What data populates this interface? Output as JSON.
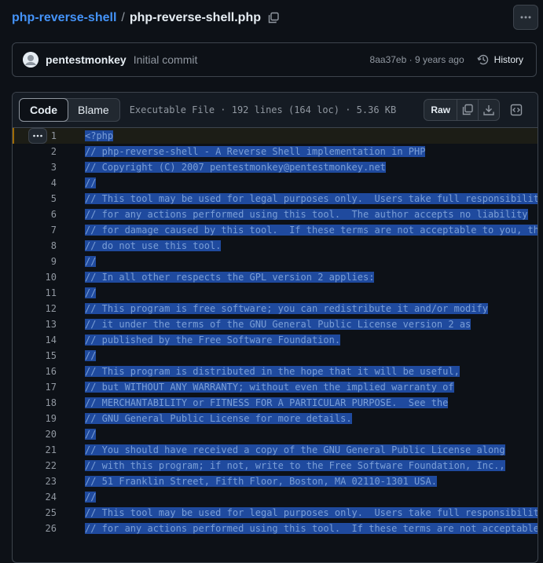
{
  "breadcrumb": {
    "repo": "php-reverse-shell",
    "separator": "/",
    "file": "php-reverse-shell.php"
  },
  "commit": {
    "author": "pentestmonkey",
    "message": "Initial commit",
    "sha": "8aa37eb",
    "age": "9 years ago",
    "history_label": "History"
  },
  "file_header": {
    "tabs": [
      {
        "label": "Code",
        "active": true
      },
      {
        "label": "Blame",
        "active": false
      }
    ],
    "info": "Executable File · 192 lines (164 loc) · 5.36 KB",
    "raw_label": "Raw"
  },
  "colors": {
    "accent": "#4493f8",
    "selection": "#1f4a9e",
    "background": "#0d1117"
  },
  "icons": [
    "copy-icon",
    "kebab-icon",
    "history-icon",
    "download-icon",
    "symbols-icon",
    "ellipsis-icon"
  ],
  "code_lines": [
    {
      "n": "1",
      "t": "<?php"
    },
    {
      "n": "2",
      "t": "// php-reverse-shell - A Reverse Shell implementation in PHP"
    },
    {
      "n": "3",
      "t": "// Copyright (C) 2007 pentestmonkey@pentestmonkey.net"
    },
    {
      "n": "4",
      "t": "//"
    },
    {
      "n": "5",
      "t": "// This tool may be used for legal purposes only.  Users take full responsibilit"
    },
    {
      "n": "6",
      "t": "// for any actions performed using this tool.  The author accepts no liability"
    },
    {
      "n": "7",
      "t": "// for damage caused by this tool.  If these terms are not acceptable to you, th"
    },
    {
      "n": "8",
      "t": "// do not use this tool."
    },
    {
      "n": "9",
      "t": "//"
    },
    {
      "n": "10",
      "t": "// In all other respects the GPL version 2 applies:"
    },
    {
      "n": "11",
      "t": "//"
    },
    {
      "n": "12",
      "t": "// This program is free software; you can redistribute it and/or modify"
    },
    {
      "n": "13",
      "t": "// it under the terms of the GNU General Public License version 2 as"
    },
    {
      "n": "14",
      "t": "// published by the Free Software Foundation."
    },
    {
      "n": "15",
      "t": "//"
    },
    {
      "n": "16",
      "t": "// This program is distributed in the hope that it will be useful,"
    },
    {
      "n": "17",
      "t": "// but WITHOUT ANY WARRANTY; without even the implied warranty of"
    },
    {
      "n": "18",
      "t": "// MERCHANTABILITY or FITNESS FOR A PARTICULAR PURPOSE.  See the"
    },
    {
      "n": "19",
      "t": "// GNU General Public License for more details."
    },
    {
      "n": "20",
      "t": "//"
    },
    {
      "n": "21",
      "t": "// You should have received a copy of the GNU General Public License along"
    },
    {
      "n": "22",
      "t": "// with this program; if not, write to the Free Software Foundation, Inc.,"
    },
    {
      "n": "23",
      "t": "// 51 Franklin Street, Fifth Floor, Boston, MA 02110-1301 USA."
    },
    {
      "n": "24",
      "t": "//"
    },
    {
      "n": "25",
      "t": "// This tool may be used for legal purposes only.  Users take full responsibilit"
    },
    {
      "n": "26",
      "t": "// for any actions performed using this tool.  If these terms are not acceptable"
    }
  ]
}
